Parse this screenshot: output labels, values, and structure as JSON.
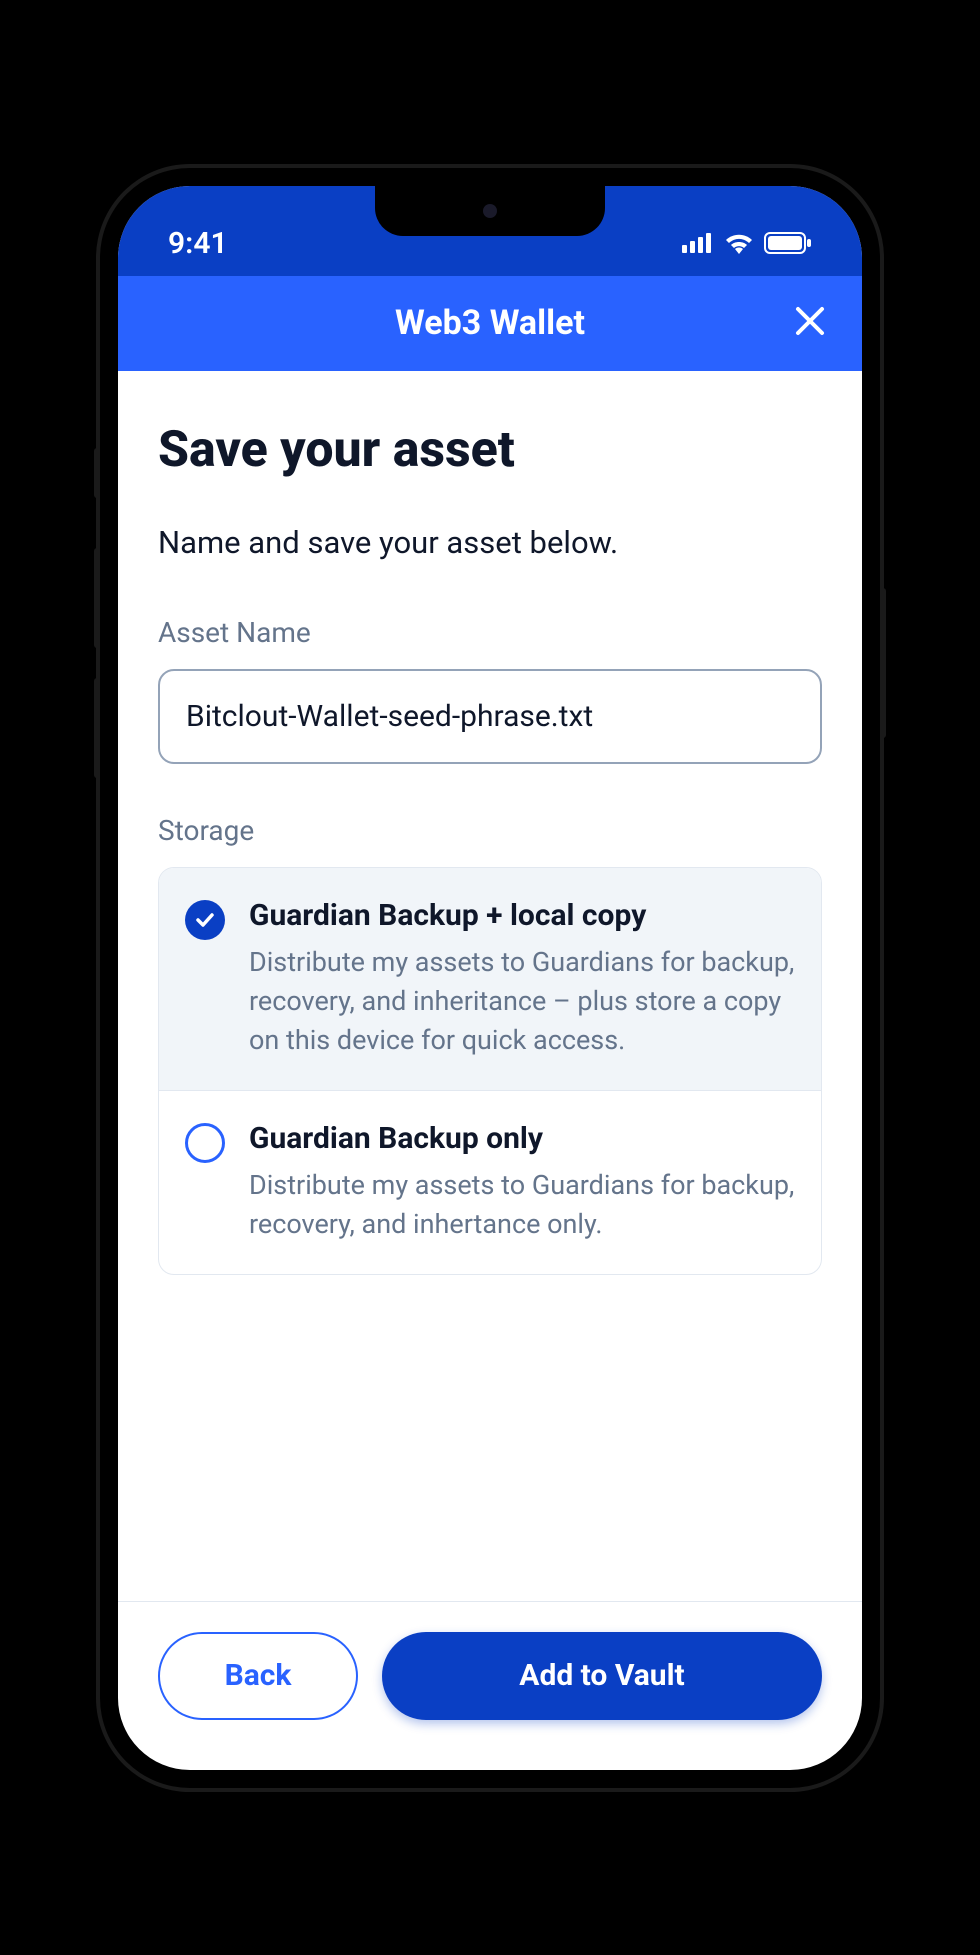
{
  "statusBar": {
    "time": "9:41"
  },
  "navBar": {
    "title": "Web3 Wallet"
  },
  "page": {
    "title": "Save your asset",
    "subtitle": "Name and save your asset below."
  },
  "assetName": {
    "label": "Asset Name",
    "value": "Bitclout-Wallet-seed-phrase.txt"
  },
  "storage": {
    "label": "Storage",
    "options": [
      {
        "title": "Guardian Backup + local copy",
        "description": "Distribute my assets to Guardians for backup, recovery, and inheritance – plus store a copy on this device for quick access.",
        "selected": true
      },
      {
        "title": "Guardian Backup only",
        "description": "Distribute my assets to Guardians for backup, recovery, and inhertance only.",
        "selected": false
      }
    ]
  },
  "footer": {
    "backLabel": "Back",
    "addLabel": "Add to Vault"
  }
}
